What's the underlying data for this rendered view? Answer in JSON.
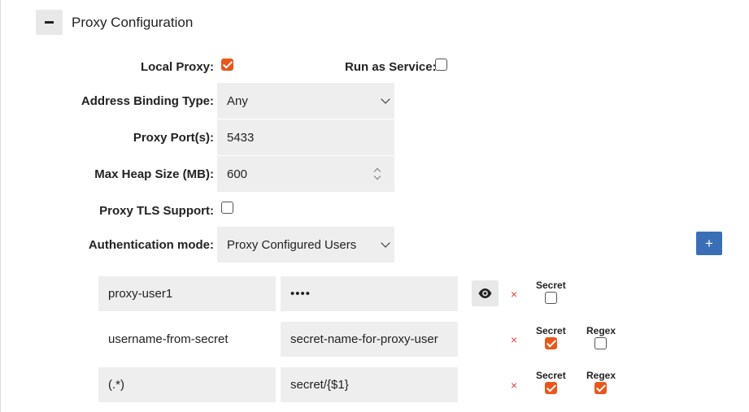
{
  "section": {
    "title": "Proxy Configuration"
  },
  "form": {
    "local_proxy": {
      "label": "Local Proxy:",
      "checked": true
    },
    "run_as_service": {
      "label": "Run as Service:",
      "checked": false
    },
    "address_binding": {
      "label": "Address Binding Type:",
      "value": "Any"
    },
    "proxy_ports": {
      "label": "Proxy Port(s):",
      "value": "5433"
    },
    "max_heap": {
      "label": "Max Heap Size (MB):",
      "value": "600"
    },
    "tls": {
      "label": "Proxy TLS Support:",
      "checked": false
    },
    "auth_mode": {
      "label": "Authentication mode:",
      "value": "Proxy Configured Users"
    }
  },
  "add_button": "+",
  "users": [
    {
      "username": "proxy-user1",
      "password": "••••",
      "secret_label": "Secret",
      "secret": false,
      "remove": "×"
    },
    {
      "username": "username-from-secret",
      "password": "secret-name-for-proxy-user",
      "secret_label": "Secret",
      "secret": true,
      "regex_label": "Regex",
      "regex": false,
      "remove": "×"
    },
    {
      "username": "(.*)",
      "password": "secret/{$1}",
      "secret_label": "Secret",
      "secret": true,
      "regex_label": "Regex",
      "regex": true,
      "remove": "×"
    }
  ],
  "colors": {
    "accent": "#e8571c",
    "primary_button": "#3a6fb6",
    "field_bg": "#eeeeee",
    "remove": "#d9453b"
  }
}
